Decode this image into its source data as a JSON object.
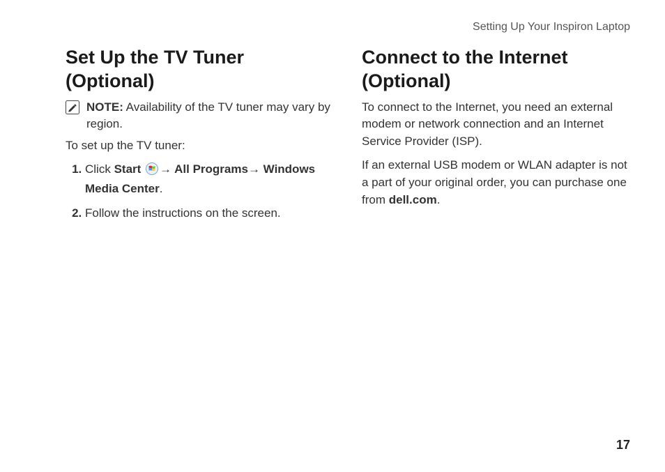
{
  "header": {
    "running_head": "Setting Up Your Inspiron Laptop"
  },
  "left": {
    "title": "Set Up the TV Tuner (Optional)",
    "note_label": "NOTE:",
    "note_text": " Availability of the TV tuner may vary by region.",
    "intro": "To set up the TV tuner:",
    "step1_click": "Click ",
    "step1_start": "Start ",
    "step1_arrow1": "→ ",
    "step1_allprograms": "All Programs",
    "step1_arrow2": "→ ",
    "step1_wmc": "Windows Media Center",
    "step1_period": ".",
    "step2": "Follow the instructions on the screen."
  },
  "right": {
    "title": "Connect to the Internet (Optional)",
    "para1": "To connect to the Internet, you need an external modem or network connection and an Internet Service Provider (ISP).",
    "para2_a": "If an external USB modem or WLAN adapter is not a part of your original order, you can purchase one from ",
    "para2_b": "dell.com",
    "para2_c": "."
  },
  "page_number": "17"
}
